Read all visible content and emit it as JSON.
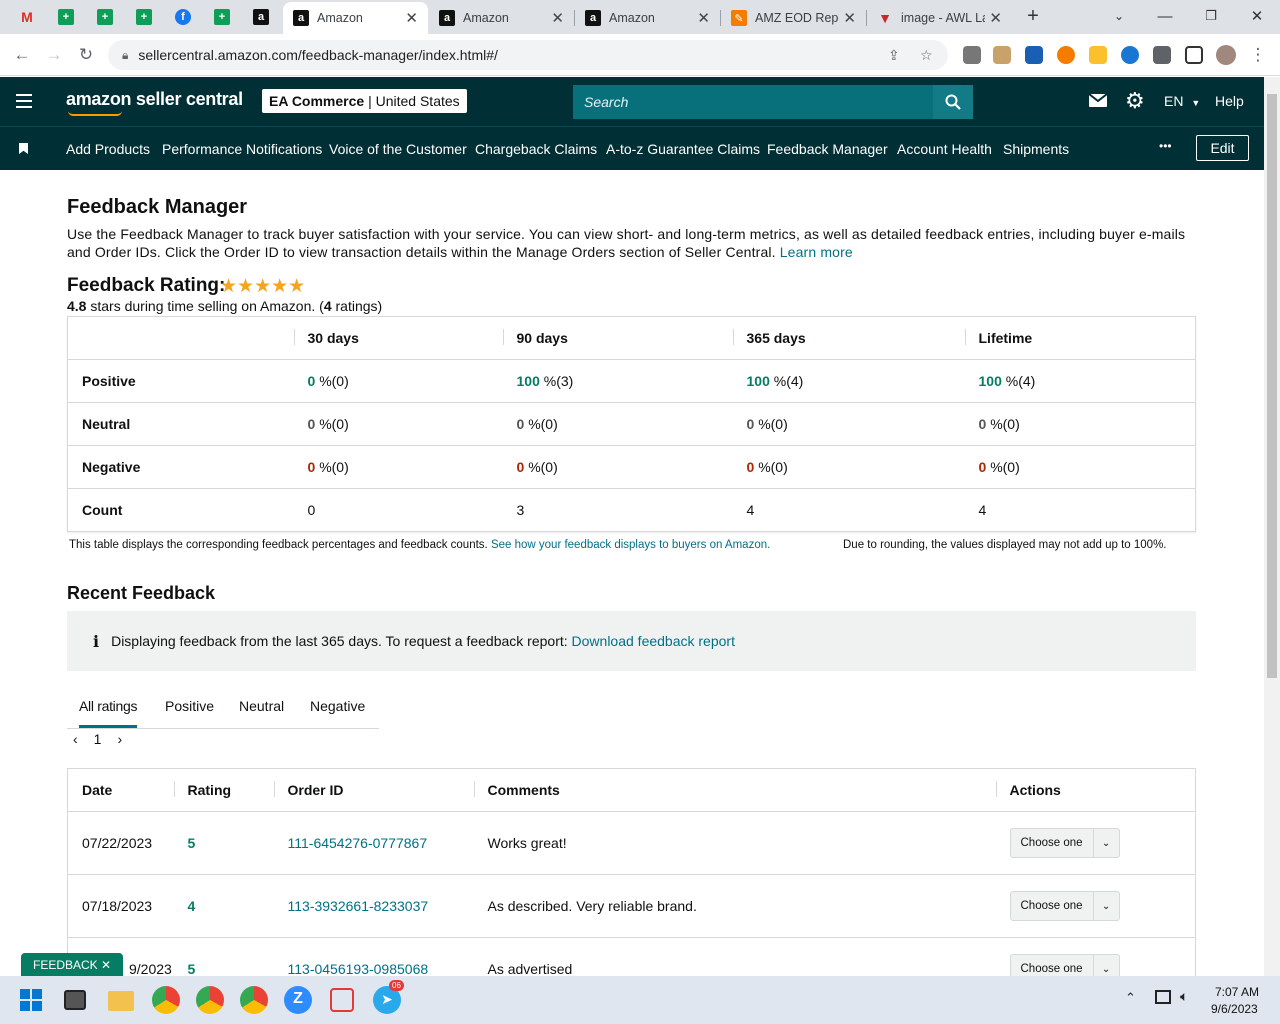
{
  "browser": {
    "tabs": [
      {
        "title": "Amazon",
        "active": true
      },
      {
        "title": "Amazon",
        "active": false
      },
      {
        "title": "Amazon",
        "active": false
      },
      {
        "title": "AMZ EOD Repo",
        "active": false
      },
      {
        "title": "image - AWL La",
        "active": false
      }
    ],
    "url": "sellercentral.amazon.com/feedback-manager/index.html#/"
  },
  "header": {
    "logo": "amazon seller central",
    "store_name": "EA Commerce",
    "store_region": "United States",
    "search_placeholder": "Search",
    "language": "EN",
    "help": "Help"
  },
  "nav": {
    "items": [
      "Add Products",
      "Performance Notifications",
      "Voice of the Customer",
      "Chargeback Claims",
      "A-to-z Guarantee Claims",
      "Feedback Manager",
      "Account Health",
      "Shipments"
    ],
    "more": "•••",
    "edit": "Edit"
  },
  "page": {
    "title": "Feedback Manager",
    "description": "Use the Feedback Manager to track buyer satisfaction with your service. You can view short- and long-term metrics, as well as detailed feedback entries, including buyer e-mails and Order IDs. Click the Order ID to view transaction details within the Manage Orders section of Seller Central.",
    "learn_more": "Learn more",
    "rating_title": "Feedback Rating:",
    "stars": "★★★★★",
    "rating_value": "4.8",
    "rating_text": "stars during time selling on Amazon. (",
    "rating_count": "4",
    "rating_suffix": "ratings)"
  },
  "summary": {
    "headers": [
      "30 days",
      "90 days",
      "365 days",
      "Lifetime"
    ],
    "rows": [
      {
        "label": "Positive",
        "cells": [
          {
            "v": "0",
            "c": "%(0)"
          },
          {
            "v": "100",
            "c": "%(3)"
          },
          {
            "v": "100",
            "c": "%(4)"
          },
          {
            "v": "100",
            "c": "%(4)"
          }
        ]
      },
      {
        "label": "Neutral",
        "cells": [
          {
            "v": "0",
            "c": "%(0)"
          },
          {
            "v": "0",
            "c": "%(0)"
          },
          {
            "v": "0",
            "c": "%(0)"
          },
          {
            "v": "0",
            "c": "%(0)"
          }
        ]
      },
      {
        "label": "Negative",
        "cells": [
          {
            "v": "0",
            "c": "%(0)"
          },
          {
            "v": "0",
            "c": "%(0)"
          },
          {
            "v": "0",
            "c": "%(0)"
          },
          {
            "v": "0",
            "c": "%(0)"
          }
        ]
      }
    ],
    "count_label": "Count",
    "counts": [
      "0",
      "3",
      "4",
      "4"
    ],
    "note": "This table displays the corresponding feedback percentages and feedback counts.",
    "note_link": "See how your feedback displays to buyers on Amazon.",
    "rounding_note": "Due to rounding, the values displayed may not add up to 100%."
  },
  "recent": {
    "title": "Recent Feedback",
    "info_text": "Displaying feedback from the last 365 days. To request a feedback report:",
    "info_link": "Download feedback report",
    "filters": [
      "All ratings",
      "Positive",
      "Neutral",
      "Negative"
    ],
    "page": "1",
    "columns": [
      "Date",
      "Rating",
      "Order ID",
      "Comments",
      "Actions"
    ],
    "rows": [
      {
        "date": "07/22/2023",
        "rating": "5",
        "order": "111-6454276-0777867",
        "comment": "Works great!",
        "action": "Choose one"
      },
      {
        "date": "07/18/2023",
        "rating": "4",
        "order": "113-3932661-8233037",
        "comment": "As described. Very reliable brand.",
        "action": "Choose one"
      },
      {
        "date": "9/2023",
        "rating": "5",
        "order": "113-0456193-0985068",
        "comment": "As advertised",
        "action": "Choose one"
      }
    ]
  },
  "feedback_pill": "FEEDBACK ✕",
  "taskbar": {
    "time": "7:07 AM",
    "date": "9/6/2023",
    "badge": "06"
  }
}
